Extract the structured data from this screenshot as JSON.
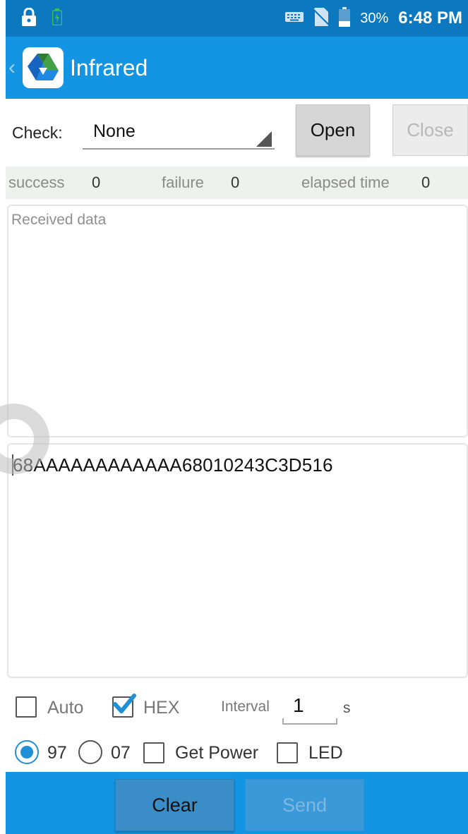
{
  "status_bar": {
    "battery_percent": "30%",
    "time": "6:48 PM",
    "icons": [
      "lock-icon",
      "battery-saver-icon",
      "keyboard-icon",
      "no-sim-icon",
      "battery-icon"
    ]
  },
  "app_bar": {
    "title": "Infrared",
    "icons": [
      "back-chevron-icon",
      "app-logo-icon"
    ]
  },
  "check": {
    "label": "Check:",
    "selected": "None"
  },
  "buttons": {
    "open": "Open",
    "close": "Close",
    "clear": "Clear",
    "send": "Send"
  },
  "stats": {
    "success_label": "success",
    "success_value": "0",
    "failure_label": "failure",
    "failure_value": "0",
    "elapsed_label": "elapsed time",
    "elapsed_value": "0"
  },
  "received": {
    "placeholder": "Received data"
  },
  "send_input": {
    "value": "68AAAAAAAAAAAA68010243C3D516"
  },
  "options": {
    "auto_label": "Auto",
    "auto_checked": false,
    "hex_label": "HEX",
    "hex_checked": true,
    "interval_label": "Interval",
    "interval_value": "1",
    "interval_unit": "s",
    "radio_97_label": "97",
    "radio_97_selected": true,
    "radio_07_label": "07",
    "radio_07_selected": false,
    "get_power_label": "Get Power",
    "get_power_checked": false,
    "led_label": "LED",
    "led_checked": false
  },
  "colors": {
    "status_bar": "#0b78bf",
    "app_bar": "#1495e3",
    "accent": "#1f8fd6"
  }
}
